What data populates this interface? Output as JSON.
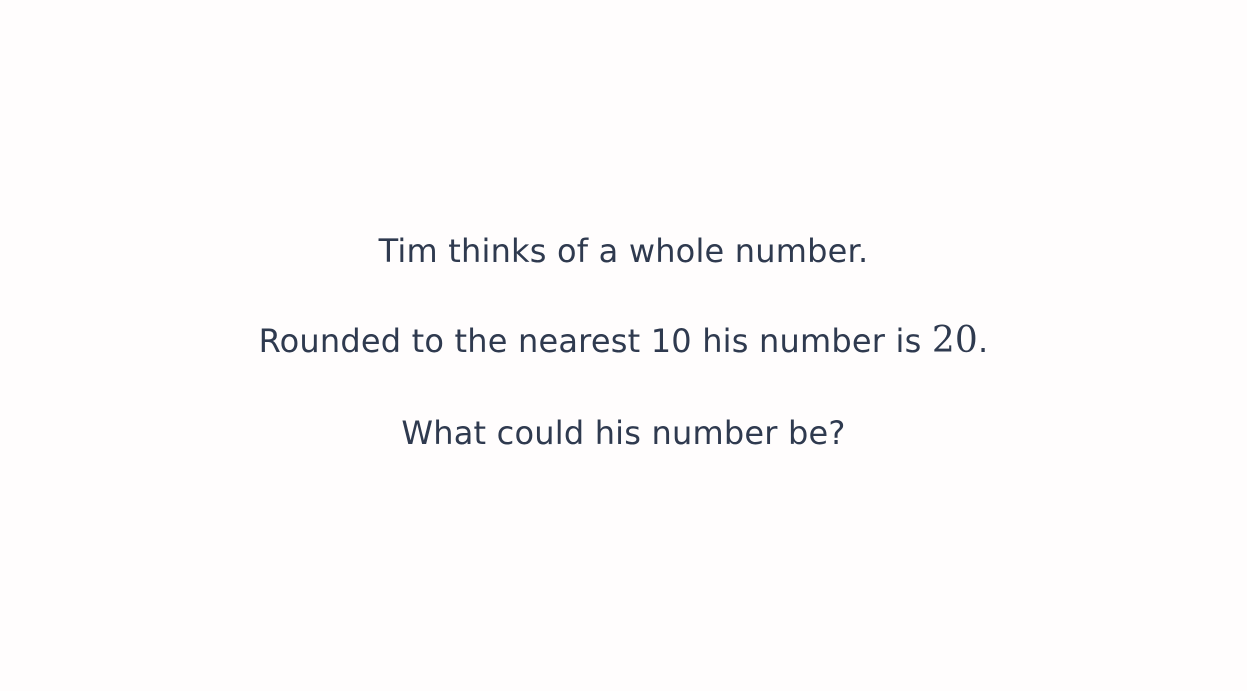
{
  "question": {
    "line1": "Tim thinks of a whole number.",
    "line2_prefix": "Rounded to the nearest 10 his number is ",
    "line2_value": "20",
    "line2_suffix": ".",
    "line3": "What could his number be?"
  },
  "colors": {
    "background": "#fffdfd",
    "text": "#2f3a4f"
  }
}
